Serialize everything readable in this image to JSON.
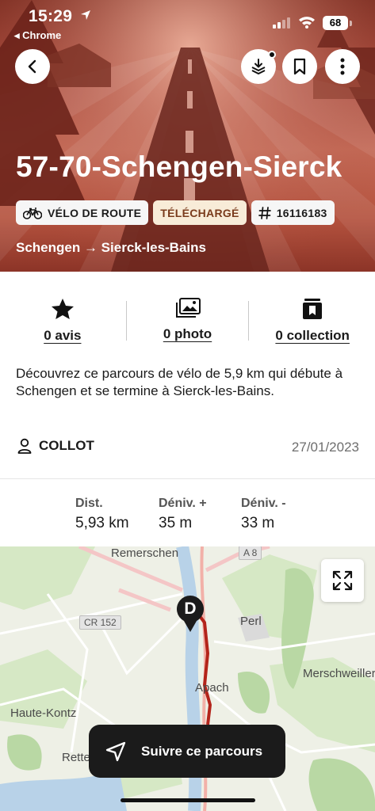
{
  "status_bar": {
    "time": "15:29",
    "back_app": "◂ Chrome",
    "battery": "68"
  },
  "hero": {
    "title": "57-70-Schengen-Sierck",
    "tags": {
      "activity": "VÉLO DE ROUTE",
      "state": "TÉLÉCHARGÉ",
      "id": "16116183"
    },
    "route": "Schengen → Sierck-les-Bains"
  },
  "social": {
    "reviews": "0 avis",
    "photos": "0 photo",
    "collections": "0 collection"
  },
  "description": "Découvrez ce parcours de vélo de 5,9 km qui débute à Schengen et se termine à Sierck-les-Bains.",
  "author": "COLLOT",
  "date": "27/01/2023",
  "metrics": {
    "distance": {
      "label": "Dist.",
      "value": "5,93 km"
    },
    "ascent": {
      "label": "Déniv. +",
      "value": "35 m"
    },
    "descent": {
      "label": "Déniv. -",
      "value": "33 m"
    }
  },
  "map": {
    "labels": {
      "remerschen": "Remerschen",
      "perl": "Perl",
      "apach": "Apach",
      "merschweiller": "Merschweiller",
      "haute_kontz": "Haute-Kontz",
      "rettel": "Rettel"
    },
    "road_tags": {
      "a8": "A 8",
      "cr152": "CR 152"
    },
    "start_marker": "D"
  },
  "follow_button": "Suivre ce parcours",
  "colors": {
    "hero": "#b5533f",
    "route_line": "#b3241b",
    "dark_button": "#1b1b1b"
  }
}
